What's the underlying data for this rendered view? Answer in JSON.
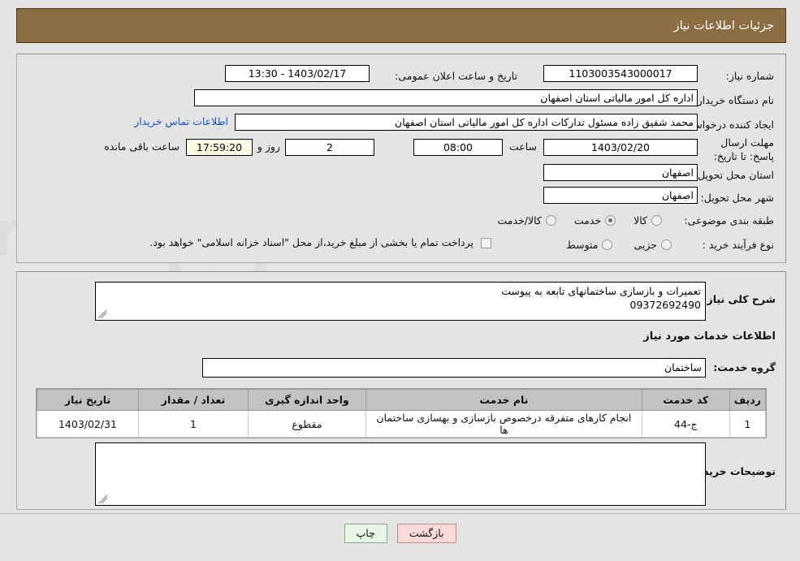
{
  "header": {
    "title": "جزئیات اطلاعات نیاز"
  },
  "top_form": {
    "need_number_label": "شماره نیاز:",
    "need_number_value": "1103003543000017",
    "announce_datetime_label": "تاریخ و ساعت اعلان عمومی:",
    "announce_datetime_value": "1403/02/17 - 13:30",
    "buyer_org_label": "نام دستگاه خریدار:",
    "buyer_org_value": "اداره کل امور مالیاتی استان اصفهان",
    "creator_label": "ایجاد کننده درخواست:",
    "creator_value": "محمد شفیق زاده مسئول تدارکات اداره کل امور مالیاتی استان اصفهان",
    "contact_link": "اطلاعات تماس خریدار",
    "deadline_label": "مهلت ارسال پاسخ: تا تاریخ:",
    "deadline_date": "1403/02/20",
    "hour_label": "ساعت",
    "deadline_time": "08:00",
    "days_value": "2",
    "days_label": "روز و",
    "countdown_value": "17:59:20",
    "remaining_label": "ساعت باقی مانده",
    "province_label": "استان محل تحویل:",
    "province_value": "اصفهان",
    "city_label": "شهر محل تحویل:",
    "city_value": "اصفهان",
    "category_label": "طبقه بندی موضوعی:",
    "category_options": [
      {
        "label": "کالا",
        "selected": false
      },
      {
        "label": "خدمت",
        "selected": true
      },
      {
        "label": "کالا/خدمت",
        "selected": false
      }
    ],
    "process_label": "نوع فرآیند خرید :",
    "process_options": [
      {
        "label": "جزیی",
        "selected": false
      },
      {
        "label": "متوسط",
        "selected": false
      }
    ],
    "treasury_note": "پرداخت تمام یا بخشی از مبلغ خرید،از محل \"اسناد خزانه اسلامی\" خواهد بود."
  },
  "description": {
    "general_label": "شرح کلی نیاز:",
    "general_value_line1": "تعمیرات و بازسازی ساختمانهای تابعه به پیوست",
    "general_value_line2": "09372692490",
    "services_heading": "اطلاعات خدمات مورد نیاز",
    "service_group_label": "گروه خدمت:",
    "service_group_value": "ساختمان",
    "buyer_notes_label": "توضیحات خریدار:",
    "buyer_notes_value": ""
  },
  "table": {
    "headers": [
      "ردیف",
      "کد خدمت",
      "نام خدمت",
      "واحد اندازه گیری",
      "تعداد / مقدار",
      "تاریخ نیاز"
    ],
    "rows": [
      {
        "index": "1",
        "code": "ج-44",
        "name": "انجام کارهای متفرقه درخصوص بازسازی و بهسازی ساختمان ها",
        "unit": "مقطوع",
        "quantity": "1",
        "need_date": "1403/02/31"
      }
    ]
  },
  "footer": {
    "print_label": "چاپ",
    "back_label": "بازگشت"
  },
  "colors": {
    "header_bg": "#8d6e43",
    "page_bg": "#e4e4e4",
    "link": "#1b50c8",
    "table_header_bg": "#c2c2c2",
    "print_btn": "#e8f6e8",
    "back_btn": "#fadbd9",
    "countdown_bg": "#fcfbe3"
  },
  "watermark": {
    "text": "AnaTender.net"
  }
}
